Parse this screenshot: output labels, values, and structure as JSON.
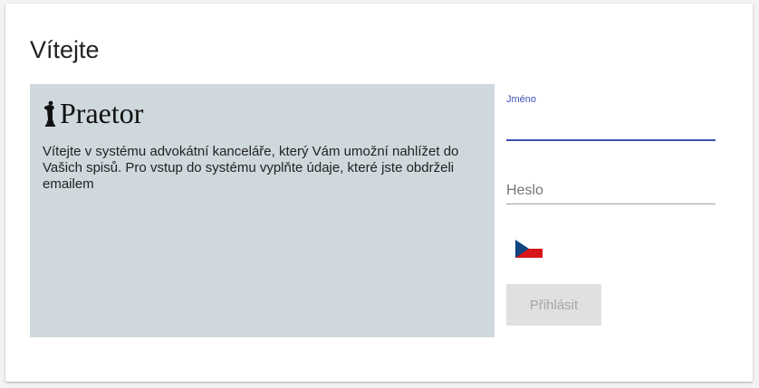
{
  "page": {
    "title": "Vítejte"
  },
  "info": {
    "logo_text": "Praetor",
    "description": "Vítejte v systému advokátní kanceláře, který Vám umožní nahlížet do Vašich spisů. Pro vstup do systému vyplňte údaje, které jste obdrželi emailem"
  },
  "login_form": {
    "username": {
      "label": "Jméno",
      "value": ""
    },
    "password": {
      "placeholder": "Heslo",
      "value": ""
    },
    "language": {
      "icon": "czech-flag-icon"
    },
    "submit": {
      "label": "Přihlásit",
      "disabled": true
    }
  },
  "colors": {
    "accent": "#3f51b5",
    "panel_background": "#cfd8dc",
    "button_disabled_bg": "#e0e0e0",
    "button_disabled_text": "#a6a6a6"
  }
}
